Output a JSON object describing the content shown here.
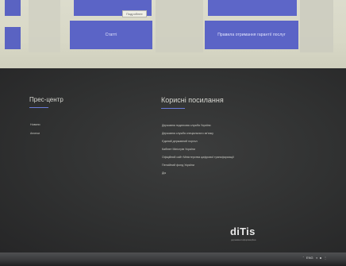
{
  "top": {
    "tooltip": "Подробнее",
    "button_left": "Статті",
    "button_right": "Правила отримання гарантії послуг"
  },
  "footer": {
    "press_center": {
      "title": "Прес-центр",
      "items": [
        "Новини",
        "Анонси"
      ]
    },
    "useful_links": {
      "title": "Корисні посилання",
      "items": [
        "Державна податкова служба України",
        "Державна служба спеціального зв'язку",
        "Єдиний державний портал",
        "Кабінет Міністрів України",
        "Офіційний сайт Міністерства цифрової трансформації",
        "Пенсійний фонд України",
        "Дія"
      ]
    },
    "logo": "diTis",
    "logo_sub": "державна інформаційна"
  },
  "taskbar": {
    "items": [
      "ˆ",
      "ENG",
      "◑",
      "⋮"
    ]
  }
}
